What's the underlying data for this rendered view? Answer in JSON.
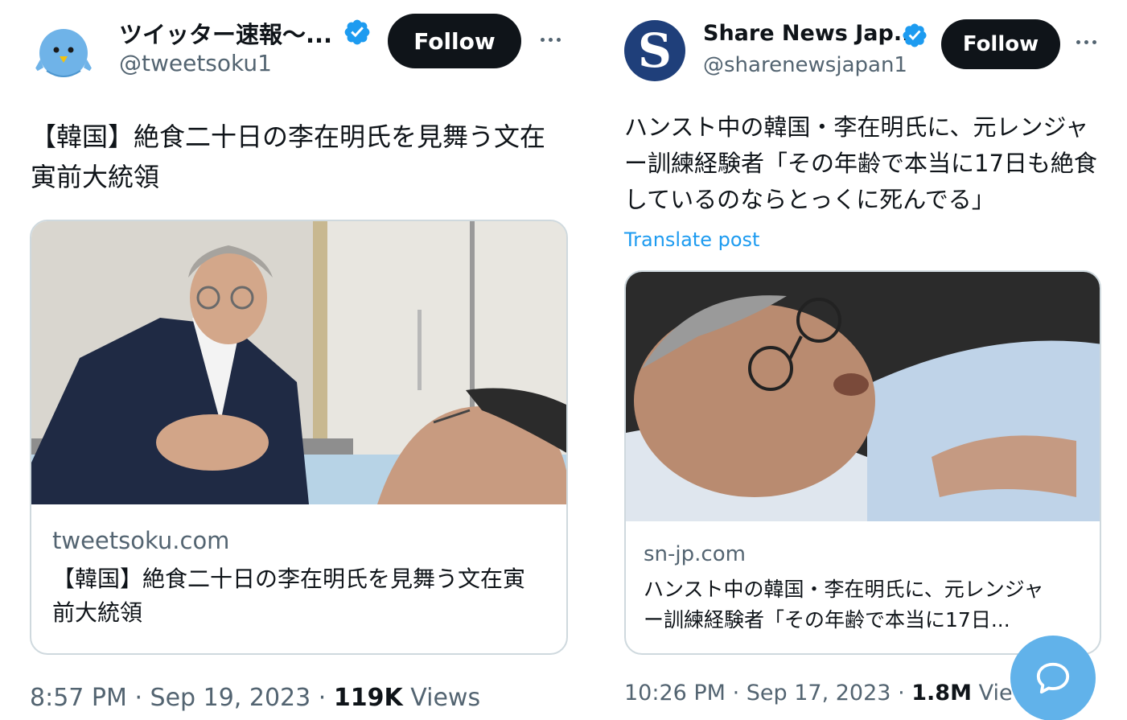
{
  "tweets": [
    {
      "display_name": "ツイッター速報〜...",
      "handle": "@tweetsoku1",
      "follow_label": "Follow",
      "body": "【韓国】絶食二十日の李在明氏を見舞う文在寅前大統領",
      "card": {
        "domain": "tweetsoku.com",
        "title": "【韓国】絶食二十日の李在明氏を見舞う文在寅前大統領"
      },
      "time": "8:57 PM",
      "date": "Sep 19, 2023",
      "views_count": "119K",
      "views_label": "Views"
    },
    {
      "display_name": "Share News Jap...",
      "avatar_letter": "S",
      "handle": "@sharenewsjapan1",
      "follow_label": "Follow",
      "body": "ハンスト中の韓国・李在明氏に、元レンジャー訓練経験者「その年齢で本当に17日も絶食しているのならとっくに死んでる」",
      "translate_label": "Translate post",
      "card": {
        "domain": "sn-jp.com",
        "title": "ハンスト中の韓国・李在明氏に、元レンジャー訓練経験者「その年齢で本当に17日..."
      },
      "time": "10:26 PM",
      "date": "Sep 17, 2023",
      "views_count": "1.8M",
      "views_label": "Views"
    }
  ],
  "separator": "·",
  "colors": {
    "accent": "#1d9bf0",
    "follow_bg": "#0f1419",
    "muted": "#536471",
    "fab": "#61b2ea"
  }
}
